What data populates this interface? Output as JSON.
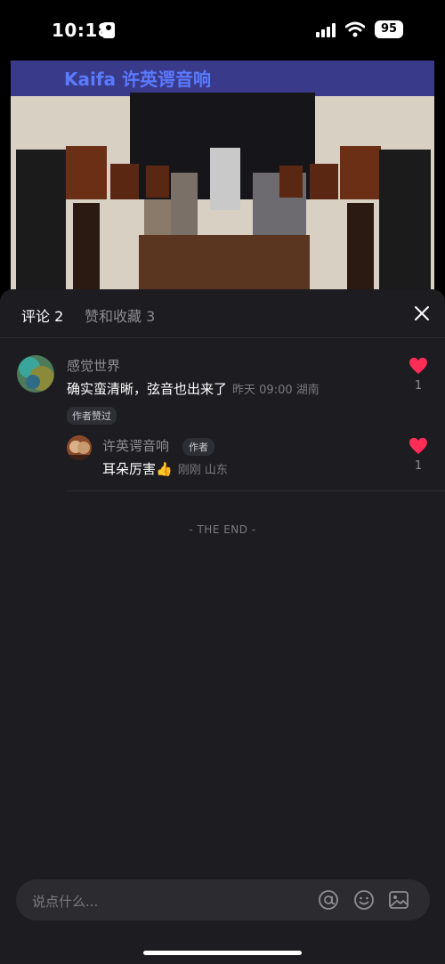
{
  "status_bar": {
    "time": "10:18",
    "battery": "95"
  },
  "tabs": {
    "comments": "评论 2",
    "likes": "赞和收藏 3"
  },
  "comments": [
    {
      "user": "感觉世界",
      "text": "确实蛮清晰，弦音也出来了",
      "meta": "昨天 09:00 湖南",
      "chip": "作者赞过",
      "likes": "1"
    },
    {
      "user": "许英谔音响",
      "badge": "作者",
      "text": "耳朵厉害👍",
      "meta": "刚刚 山东",
      "likes": "1"
    }
  ],
  "end_text": "- THE END -",
  "input": {
    "placeholder": "说点什么..."
  },
  "photo_banner_text": "Kaifa 许英谔音响",
  "icons": [
    "person-icon",
    "signal-icon",
    "wifi-icon",
    "close-icon",
    "heart-icon",
    "at-icon",
    "emoji-icon",
    "image-icon"
  ],
  "colors": {
    "heart": "#ff2d55",
    "sheet_bg": "#1c1c21",
    "input_bg": "#2b2b30"
  }
}
